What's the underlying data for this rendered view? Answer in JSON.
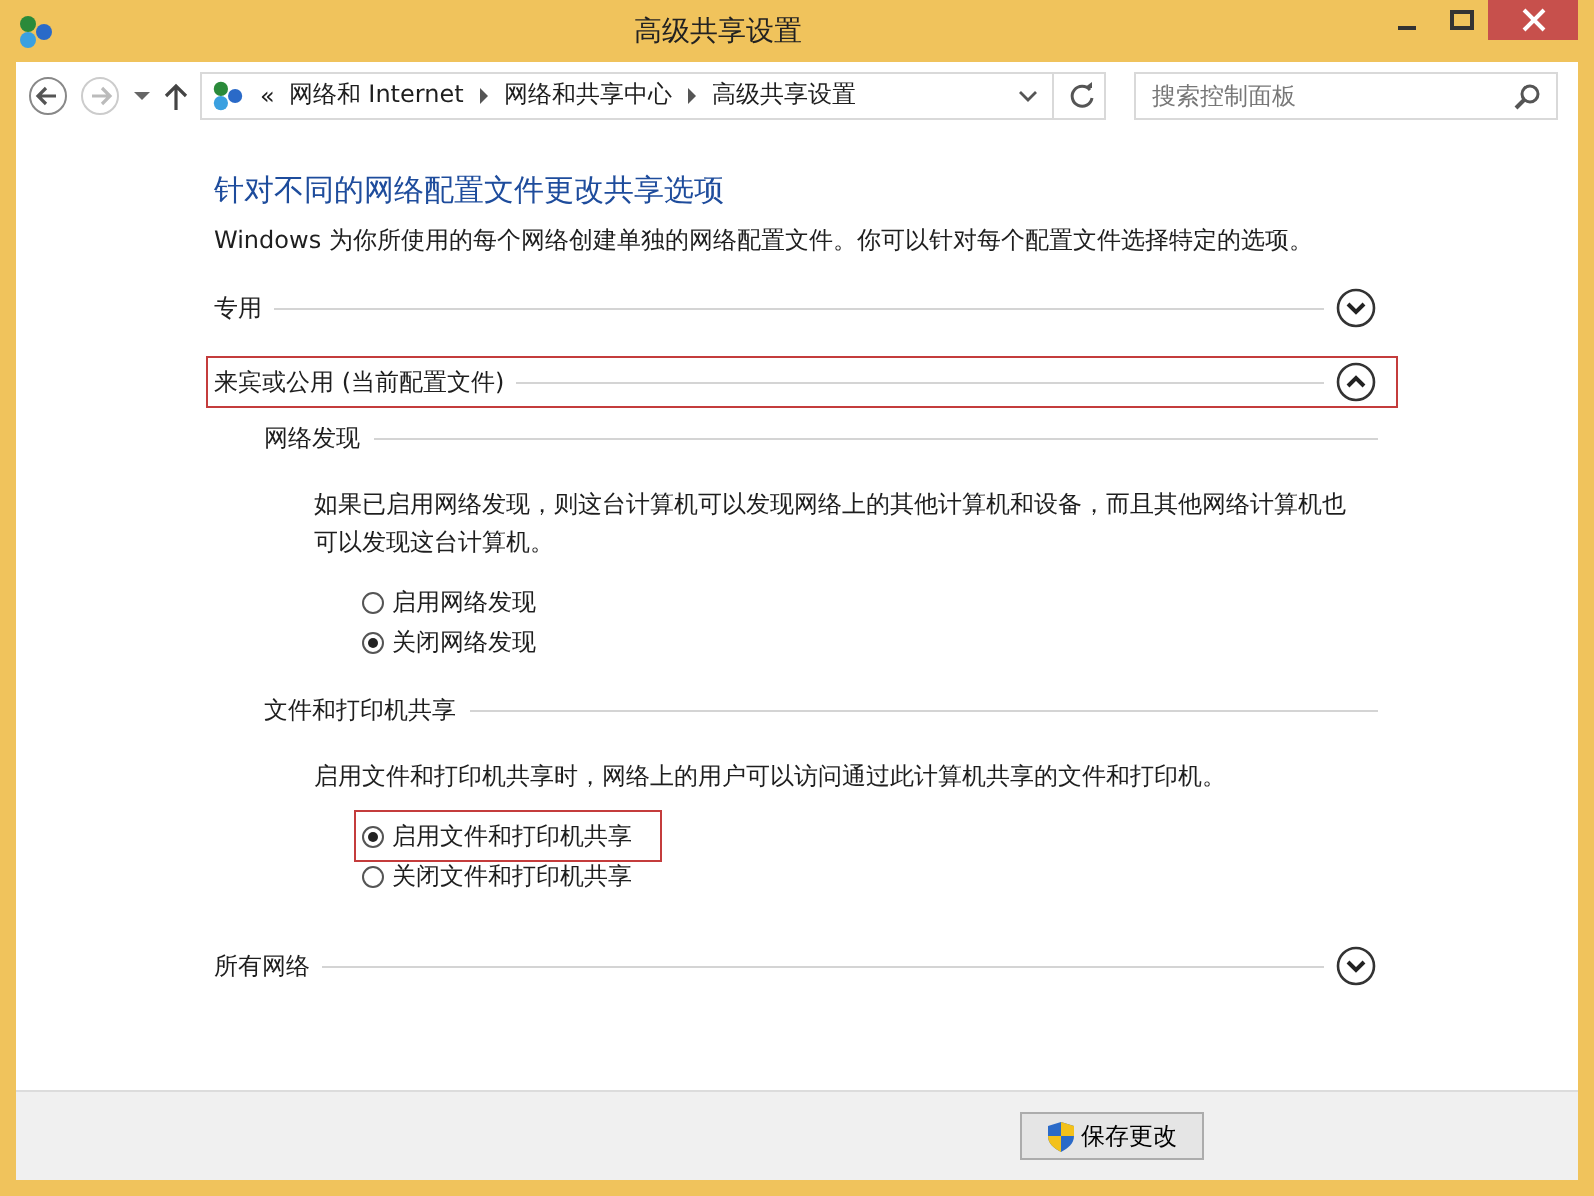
{
  "window": {
    "title": "高级共享设置"
  },
  "address_bar": {
    "crumbs_prefix": "«",
    "crumbs": [
      "网络和 Internet",
      "网络和共享中心",
      "高级共享设置"
    ]
  },
  "search": {
    "placeholder": "搜索控制面板"
  },
  "heading": "针对不同的网络配置文件更改共享选项",
  "intro": "Windows 为你所使用的每个网络创建单独的网络配置文件。你可以针对每个配置文件选择特定的选项。",
  "sections": [
    {
      "title": "专用",
      "expanded": false,
      "highlighted": false
    },
    {
      "title": "来宾或公用 (当前配置文件)",
      "expanded": true,
      "highlighted": true,
      "groups": [
        {
          "title": "网络发现",
          "description": "如果已启用网络发现，则这台计算机可以发现网络上的其他计算机和设备，而且其他网络计算机也可以发现这台计算机。",
          "options": [
            {
              "label": "启用网络发现",
              "selected": false,
              "highlighted": false
            },
            {
              "label": "关闭网络发现",
              "selected": true,
              "highlighted": false
            }
          ]
        },
        {
          "title": "文件和打印机共享",
          "description": "启用文件和打印机共享时，网络上的用户可以访问通过此计算机共享的文件和打印机。",
          "options": [
            {
              "label": "启用文件和打印机共享",
              "selected": true,
              "highlighted": true
            },
            {
              "label": "关闭文件和打印机共享",
              "selected": false,
              "highlighted": false
            }
          ]
        }
      ]
    },
    {
      "title": "所有网络",
      "expanded": false,
      "highlighted": false
    }
  ],
  "buttons": [
    "保存更改"
  ]
}
